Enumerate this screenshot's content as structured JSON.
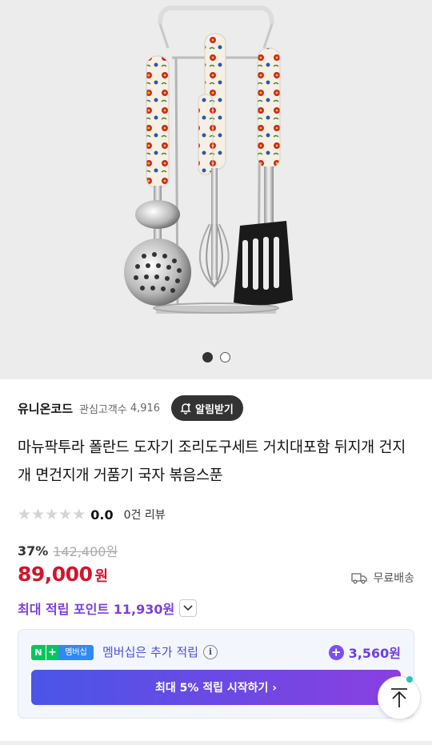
{
  "hero": {
    "image_alt": "product-photo",
    "carousel_total": 2,
    "carousel_active": 1
  },
  "store": {
    "name": "유니온코드",
    "watchers_label": "관심고객수",
    "watchers_count": "4,916",
    "alarm_label": "알림받기"
  },
  "product": {
    "title": "마뉴팍투라 폴란드 도자기 조리도구세트 거치대포함 뒤지개 건지개 면건지개 거품기 국자 볶음스푼",
    "rating_score": "0.0",
    "review_count": "0건 리뷰",
    "discount_rate": "37%",
    "original_price": "142,400원",
    "price": "89,000",
    "price_unit": "원",
    "shipping": "무료배송",
    "max_points": "최대 적립 포인트 11,930원"
  },
  "membership": {
    "badge_n": "N",
    "badge_plus": "+",
    "badge_label": "멤버십",
    "text": "멤버십은 추가 적립",
    "amount": "3,560원",
    "cta": "최대 5% 적립 시작하기 ›"
  },
  "colors": {
    "price_red": "#d3142c",
    "points_purple": "#7a3fe0",
    "naver_green": "#03c75a"
  }
}
